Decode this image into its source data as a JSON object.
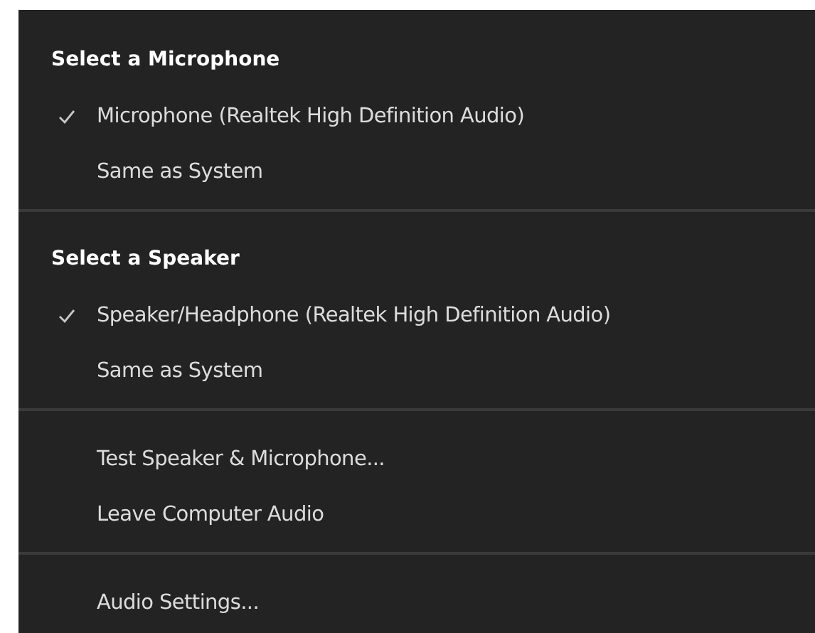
{
  "sections": [
    {
      "heading": "Select a Microphone",
      "items": [
        {
          "label": "Microphone (Realtek High Definition Audio)",
          "checked": true
        },
        {
          "label": "Same as System",
          "checked": false
        }
      ]
    },
    {
      "heading": "Select a Speaker",
      "items": [
        {
          "label": "Speaker/Headphone (Realtek High Definition Audio)",
          "checked": true
        },
        {
          "label": "Same as System",
          "checked": false
        }
      ]
    },
    {
      "items": [
        {
          "label": "Test Speaker & Microphone...",
          "checked": false
        },
        {
          "label": "Leave Computer Audio",
          "checked": false
        }
      ]
    },
    {
      "items": [
        {
          "label": "Audio Settings...",
          "checked": false
        }
      ]
    }
  ]
}
